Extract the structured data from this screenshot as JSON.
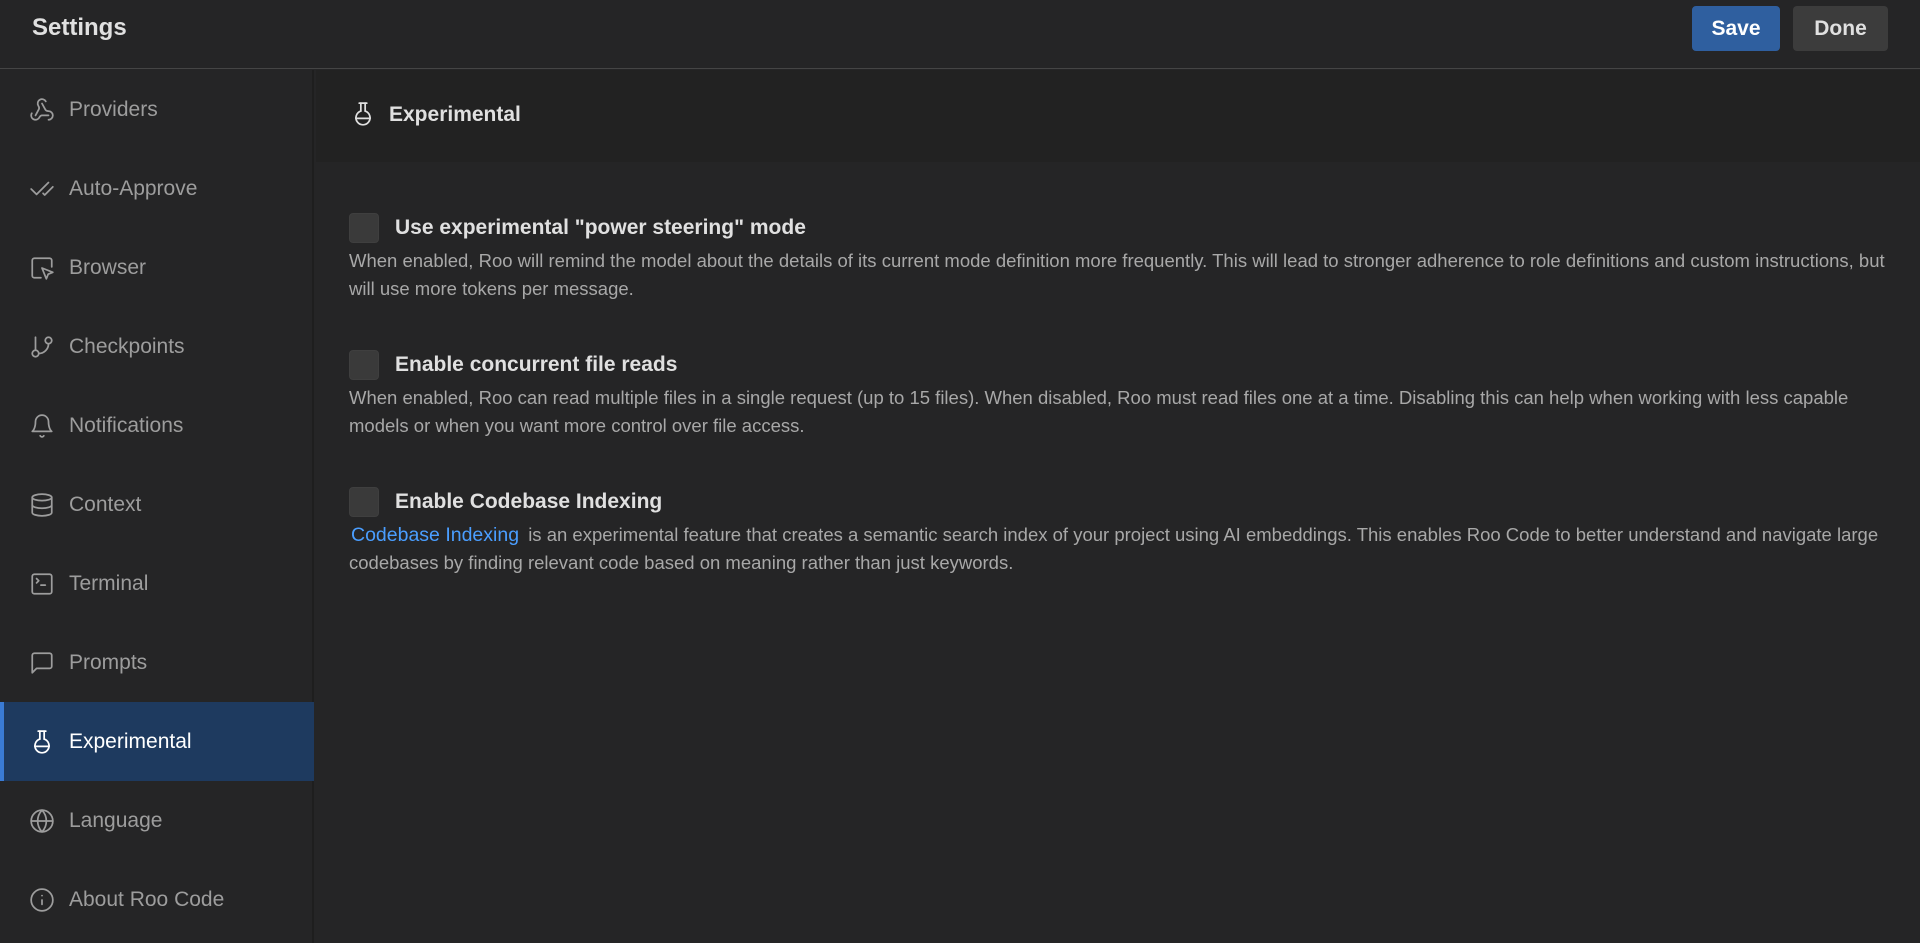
{
  "header": {
    "title": "Settings",
    "save_label": "Save",
    "done_label": "Done"
  },
  "sidebar": {
    "items": [
      {
        "label": "Providers",
        "icon": "webhook-icon"
      },
      {
        "label": "Auto-Approve",
        "icon": "check-check-icon"
      },
      {
        "label": "Browser",
        "icon": "square-mouse-pointer-icon"
      },
      {
        "label": "Checkpoints",
        "icon": "git-branch-icon"
      },
      {
        "label": "Notifications",
        "icon": "bell-icon"
      },
      {
        "label": "Context",
        "icon": "database-icon"
      },
      {
        "label": "Terminal",
        "icon": "terminal-icon"
      },
      {
        "label": "Prompts",
        "icon": "message-square-icon"
      },
      {
        "label": "Experimental",
        "icon": "flask-icon",
        "active": true
      },
      {
        "label": "Language",
        "icon": "globe-icon"
      },
      {
        "label": "About Roo Code",
        "icon": "info-icon"
      }
    ]
  },
  "section": {
    "title": "Experimental",
    "icon": "flask-icon"
  },
  "settings": [
    {
      "title": "Use experimental \"power steering\" mode",
      "checked": false,
      "description": "When enabled, Roo will remind the model about the details of its current mode definition more frequently. This will lead to stronger adherence to role definitions and custom instructions, but will use more tokens per message."
    },
    {
      "title": "Enable concurrent file reads",
      "checked": false,
      "description": "When enabled, Roo can read multiple files in a single request (up to 15 files). When disabled, Roo must read files one at a time. Disabling this can help when working with less capable models or when you want more control over file access."
    },
    {
      "title": "Enable Codebase Indexing",
      "checked": false,
      "link_text": "Codebase Indexing",
      "description": "is an experimental feature that creates a semantic search index of your project using AI embeddings. This enables Roo Code to better understand and navigate large codebases by finding relevant code based on meaning rather than just keywords."
    }
  ],
  "colors": {
    "background": "#252526",
    "accent": "#2f5f9f",
    "active_nav": "#1e3a5f",
    "link": "#4a9eff"
  }
}
